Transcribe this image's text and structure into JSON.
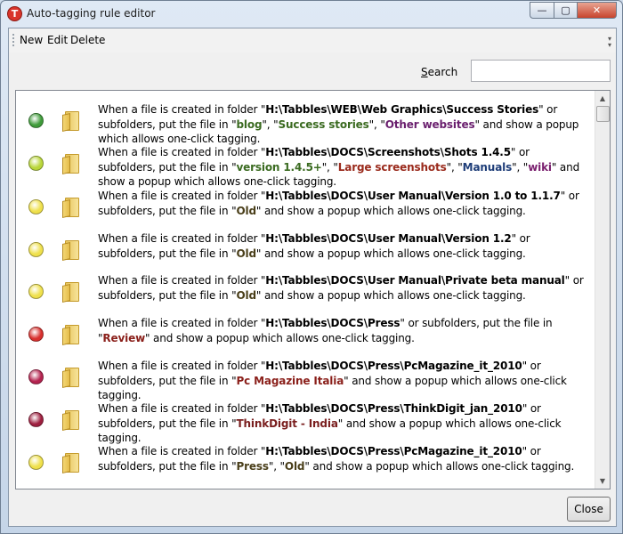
{
  "window": {
    "title": "Auto-tagging rule editor",
    "icon_letter": "T",
    "caption": {
      "minimize": "—",
      "maximize": "▢",
      "close": "✕"
    }
  },
  "menu": {
    "items": [
      "New",
      "Edit",
      "Delete"
    ]
  },
  "search": {
    "label_first": "S",
    "label_rest": "earch",
    "value": ""
  },
  "rules": [
    {
      "status_color": "#3f9b3a",
      "parts": [
        {
          "t": "When a file is created in folder \""
        },
        {
          "t": "H:\\Tabbles\\WEB\\Web Graphics\\Success Stories",
          "b": true
        },
        {
          "t": "\" or subfolders, put the file in  \""
        },
        {
          "t": "blog",
          "c": "#3b6b21"
        },
        {
          "t": "\", \""
        },
        {
          "t": "Success stories",
          "c": "#3b6b21"
        },
        {
          "t": "\", \""
        },
        {
          "t": "Other websites",
          "c": "#6a1f6e"
        },
        {
          "t": "\" and show a popup which allows one-click tagging."
        }
      ]
    },
    {
      "status_color": "#b9d63a",
      "parts": [
        {
          "t": "When a file is created in folder \""
        },
        {
          "t": "H:\\Tabbles\\DOCS\\Screenshots\\Shots 1.4.5",
          "b": true
        },
        {
          "t": "\" or subfolders, put the file in  \""
        },
        {
          "t": "version 1.4.5+",
          "c": "#3b6b21"
        },
        {
          "t": "\", \""
        },
        {
          "t": "Large screenshots",
          "c": "#9a2a1c"
        },
        {
          "t": "\", \""
        },
        {
          "t": "Manuals",
          "c": "#1e3d78"
        },
        {
          "t": "\", \""
        },
        {
          "t": "wiki",
          "c": "#7a1f6e"
        },
        {
          "t": "\" and show a popup which allows one-click tagging."
        }
      ]
    },
    {
      "status_color": "#efe04b",
      "parts": [
        {
          "t": "When a file is created in folder \""
        },
        {
          "t": "H:\\Tabbles\\DOCS\\User Manual\\Version 1.0 to 1.1.7",
          "b": true
        },
        {
          "t": "\" or subfolders, put the file in  \""
        },
        {
          "t": "Old",
          "c": "#4a3f1a"
        },
        {
          "t": "\" and show a popup which allows one-click tagging."
        }
      ]
    },
    {
      "status_color": "#efe04b",
      "parts": [
        {
          "t": "When a file is created in folder \""
        },
        {
          "t": "H:\\Tabbles\\DOCS\\User Manual\\Version 1.2",
          "b": true
        },
        {
          "t": "\" or subfolders, put the file in  \""
        },
        {
          "t": "Old",
          "c": "#4a3f1a"
        },
        {
          "t": "\" and show a popup which allows one-click tagging."
        }
      ]
    },
    {
      "status_color": "#efe04b",
      "parts": [
        {
          "t": "When a file is created in folder \""
        },
        {
          "t": "H:\\Tabbles\\DOCS\\User Manual\\Private beta manual",
          "b": true
        },
        {
          "t": "\" or subfolders, put the file in  \""
        },
        {
          "t": "Old",
          "c": "#4a3f1a"
        },
        {
          "t": "\" and show a popup which allows one-click tagging."
        }
      ]
    },
    {
      "status_color": "#d8302d",
      "parts": [
        {
          "t": "When a file is created in folder \""
        },
        {
          "t": "H:\\Tabbles\\DOCS\\Press",
          "b": true
        },
        {
          "t": "\" or subfolders, put the file in  \""
        },
        {
          "t": "Review",
          "c": "#8a1f1a"
        },
        {
          "t": "\" and show a popup which allows one-click tagging."
        }
      ]
    },
    {
      "status_color": "#b4234f",
      "parts": [
        {
          "t": "When a file is created in folder \""
        },
        {
          "t": "H:\\Tabbles\\DOCS\\Press\\PcMagazine_it_2010",
          "b": true
        },
        {
          "t": "\" or subfolders, put the file in  \""
        },
        {
          "t": "Pc Magazine Italia",
          "c": "#8a1f1a"
        },
        {
          "t": "\" and show a popup which allows one-click tagging."
        }
      ]
    },
    {
      "status_color": "#9e1f3f",
      "parts": [
        {
          "t": "When a file is created in folder \""
        },
        {
          "t": "H:\\Tabbles\\DOCS\\Press\\ThinkDigit_jan_2010",
          "b": true
        },
        {
          "t": "\" or subfolders, put the file in  \""
        },
        {
          "t": "ThinkDigit - India",
          "c": "#7a1f1f"
        },
        {
          "t": "\" and show a popup which allows one-click tagging."
        }
      ]
    },
    {
      "status_color": "#efe04b",
      "parts": [
        {
          "t": "When a file is created in folder \""
        },
        {
          "t": "H:\\Tabbles\\DOCS\\Press\\PcMagazine_it_2010",
          "b": true
        },
        {
          "t": "\" or subfolders, put the file in  \""
        },
        {
          "t": "Press",
          "c": "#4a3f1a"
        },
        {
          "t": "\", \""
        },
        {
          "t": "Old",
          "c": "#4a3f1a"
        },
        {
          "t": "\" and show a popup which allows one-click tagging."
        }
      ]
    }
  ],
  "footer": {
    "close_label": "Close"
  }
}
